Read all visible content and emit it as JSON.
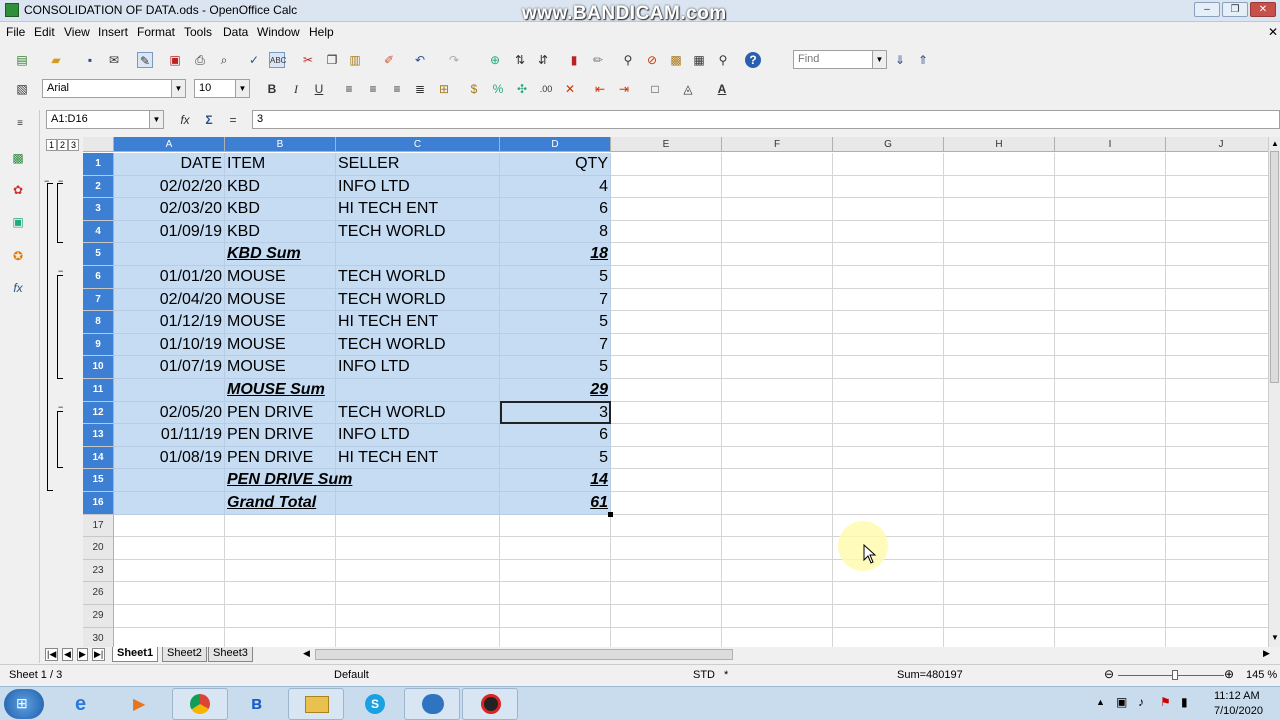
{
  "window": {
    "title": "CONSOLIDATION OF DATA.ods - OpenOffice Calc",
    "watermark": "www.BANDICAM.com"
  },
  "menu": [
    "File",
    "Edit",
    "View",
    "Insert",
    "Format",
    "Tools",
    "Data",
    "Window",
    "Help"
  ],
  "toolbar": {
    "find_placeholder": "Find",
    "font_name": "Arial",
    "font_size": "10"
  },
  "formula_bar": {
    "name_box": "A1:D16",
    "content": "3"
  },
  "outline_levels": [
    "1",
    "2",
    "3"
  ],
  "columns": [
    "A",
    "B",
    "C",
    "D",
    "E",
    "F",
    "G",
    "H",
    "I",
    "J"
  ],
  "rows": [
    {
      "num": "1",
      "a": "DATE",
      "b": "ITEM",
      "c": "SELLER",
      "d": "QTY"
    },
    {
      "num": "2",
      "a": "02/02/20",
      "b": "KBD",
      "c": "INFO LTD",
      "d": "4"
    },
    {
      "num": "3",
      "a": "02/03/20",
      "b": "KBD",
      "c": "HI TECH ENT",
      "d": "6"
    },
    {
      "num": "4",
      "a": "01/09/19",
      "b": "KBD",
      "c": "TECH WORLD",
      "d": "8"
    },
    {
      "num": "5",
      "a": "",
      "b": "KBD Sum",
      "c": "",
      "d": "18"
    },
    {
      "num": "6",
      "a": "01/01/20",
      "b": "MOUSE",
      "c": "TECH WORLD",
      "d": "5"
    },
    {
      "num": "7",
      "a": "02/04/20",
      "b": "MOUSE",
      "c": "TECH WORLD",
      "d": "7"
    },
    {
      "num": "8",
      "a": "01/12/19",
      "b": "MOUSE",
      "c": "HI TECH ENT",
      "d": "5"
    },
    {
      "num": "9",
      "a": "01/10/19",
      "b": "MOUSE",
      "c": "TECH WORLD",
      "d": "7"
    },
    {
      "num": "10",
      "a": "01/07/19",
      "b": "MOUSE",
      "c": "INFO LTD",
      "d": "5"
    },
    {
      "num": "11",
      "a": "",
      "b": "MOUSE Sum",
      "c": "",
      "d": "29"
    },
    {
      "num": "12",
      "a": "02/05/20",
      "b": "PEN DRIVE",
      "c": "TECH WORLD",
      "d": "3"
    },
    {
      "num": "13",
      "a": "01/11/19",
      "b": "PEN DRIVE",
      "c": "INFO LTD",
      "d": "6"
    },
    {
      "num": "14",
      "a": "01/08/19",
      "b": "PEN DRIVE",
      "c": "HI TECH ENT",
      "d": "5"
    },
    {
      "num": "15",
      "a": "",
      "b": "PEN DRIVE Sum",
      "c": "",
      "d": "14"
    },
    {
      "num": "16",
      "a": "",
      "b": "Grand Total",
      "c": "",
      "d": "61"
    }
  ],
  "empty_rows": [
    "17",
    "20",
    "23",
    "26",
    "29",
    "30"
  ],
  "sheet_tabs": [
    "Sheet1",
    "Sheet2",
    "Sheet3"
  ],
  "status": {
    "sheet": "Sheet 1 / 3",
    "style": "Default",
    "mode": "STD",
    "modified": "*",
    "sum": "Sum=480197",
    "zoom": "145 %"
  },
  "taskbar": {
    "time": "11:12 AM",
    "date": "7/10/2020"
  }
}
